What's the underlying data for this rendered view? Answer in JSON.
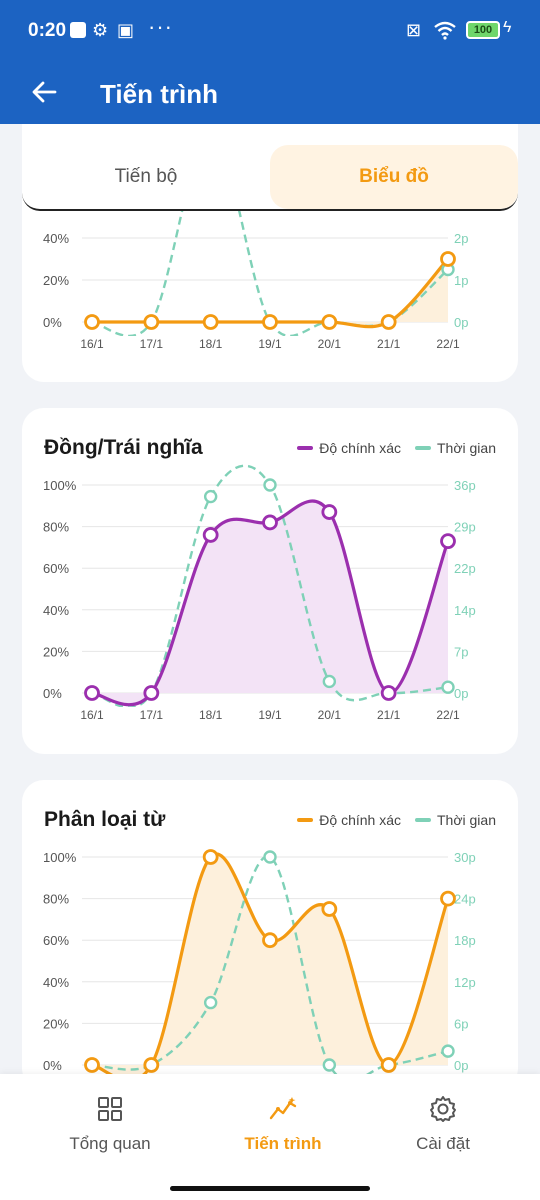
{
  "status_bar": {
    "time": "0:20",
    "battery": "100",
    "icons": [
      "gear-icon",
      "notification-icon",
      "more-icon",
      "no-sim-icon",
      "wifi-icon",
      "battery-icon",
      "charging-icon"
    ]
  },
  "app_bar": {
    "title": "Tiến trình",
    "back_icon": "arrow-left-icon"
  },
  "tabs": [
    {
      "label": "Tiến bộ",
      "active": false
    },
    {
      "label": "Biểu đồ",
      "active": true
    }
  ],
  "colors": {
    "primary": "#1c63c2",
    "accent": "#f39a12",
    "time_series": "#7fd1b7",
    "purple": "#9b2fae"
  },
  "legend": {
    "accuracy": "Độ chính xác",
    "time": "Thời gian"
  },
  "chart_data": [
    {
      "type": "line",
      "title": "",
      "x": [
        "16/1",
        "17/1",
        "18/1",
        "19/1",
        "20/1",
        "21/1",
        "22/1"
      ],
      "left_ticks": [
        "0%",
        "20%",
        "40%"
      ],
      "right_ticks": [
        "0p",
        "1p",
        "2p"
      ],
      "series": [
        {
          "values": [
            0,
            0,
            0,
            0,
            0,
            0,
            30
          ],
          "color": "#f39a12",
          "axis": "left",
          "unit": "%"
        },
        {
          "values": [
            0,
            0,
            4.5,
            0,
            0,
            0,
            1.25
          ],
          "color": "#7fd1b7",
          "axis": "right",
          "unit": "p",
          "dashed": true
        }
      ],
      "ylim_left": [
        0,
        40
      ],
      "ylim_right": [
        0,
        2
      ]
    },
    {
      "type": "line",
      "title": "Đồng/Trái nghĩa",
      "x": [
        "16/1",
        "17/1",
        "18/1",
        "19/1",
        "20/1",
        "21/1",
        "22/1"
      ],
      "left_ticks": [
        "0%",
        "20%",
        "40%",
        "60%",
        "80%",
        "100%"
      ],
      "right_ticks": [
        "0p",
        "7p",
        "14p",
        "22p",
        "29p",
        "36p"
      ],
      "series": [
        {
          "name": "Độ chính xác",
          "values": [
            0,
            0,
            76,
            82,
            87,
            0,
            73
          ],
          "color": "#9b2fae",
          "axis": "left",
          "unit": "%"
        },
        {
          "name": "Thời gian",
          "values": [
            0,
            0,
            34,
            36,
            2,
            0,
            1
          ],
          "color": "#7fd1b7",
          "axis": "right",
          "unit": "p",
          "dashed": true
        }
      ],
      "ylim_left": [
        0,
        100
      ],
      "ylim_right": [
        0,
        36
      ]
    },
    {
      "type": "line",
      "title": "Phân loại từ",
      "x": [
        "16/1",
        "17/1",
        "18/1",
        "19/1",
        "20/1",
        "21/1",
        "22/1"
      ],
      "left_ticks": [
        "0%",
        "20%",
        "40%",
        "60%",
        "80%",
        "100%"
      ],
      "right_ticks": [
        "0p",
        "6p",
        "12p",
        "18p",
        "24p",
        "30p"
      ],
      "series": [
        {
          "name": "Độ chính xác",
          "values": [
            0,
            0,
            100,
            60,
            75,
            0,
            80
          ],
          "color": "#f39a12",
          "axis": "left",
          "unit": "%"
        },
        {
          "name": "Thời gian",
          "values": [
            0,
            0,
            9,
            30,
            0,
            0,
            2
          ],
          "color": "#7fd1b7",
          "axis": "right",
          "unit": "p",
          "dashed": true
        }
      ],
      "ylim_left": [
        0,
        100
      ],
      "ylim_right": [
        0,
        30
      ]
    }
  ],
  "bottom_nav": [
    {
      "label": "Tổng quan",
      "icon": "dashboard-icon",
      "active": false
    },
    {
      "label": "Tiến trình",
      "icon": "progress-chart-icon",
      "active": true
    },
    {
      "label": "Cài đặt",
      "icon": "settings-gear-icon",
      "active": false
    }
  ]
}
